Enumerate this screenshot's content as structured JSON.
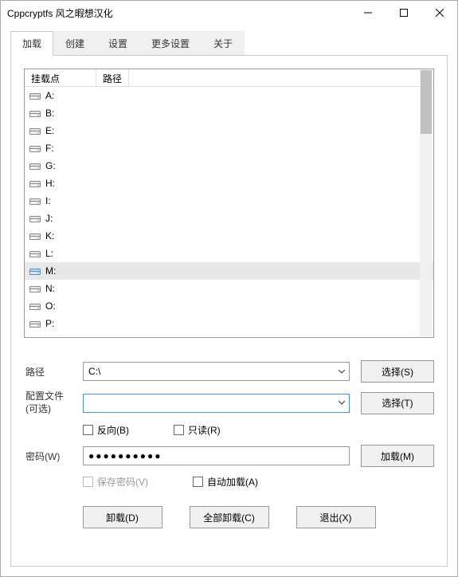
{
  "window": {
    "title": "Cppcryptfs 风之暇想汉化"
  },
  "tabs": [
    {
      "label": "加载",
      "active": true
    },
    {
      "label": "创建",
      "active": false
    },
    {
      "label": "设置",
      "active": false
    },
    {
      "label": "更多设置",
      "active": false
    },
    {
      "label": "关于",
      "active": false
    }
  ],
  "list": {
    "headers": {
      "mount": "挂载点",
      "path": "路径"
    },
    "drives": [
      {
        "letter": "A:",
        "selected": false
      },
      {
        "letter": "B:",
        "selected": false
      },
      {
        "letter": "E:",
        "selected": false
      },
      {
        "letter": "F:",
        "selected": false
      },
      {
        "letter": "G:",
        "selected": false
      },
      {
        "letter": "H:",
        "selected": false
      },
      {
        "letter": "I:",
        "selected": false
      },
      {
        "letter": "J:",
        "selected": false
      },
      {
        "letter": "K:",
        "selected": false
      },
      {
        "letter": "L:",
        "selected": false
      },
      {
        "letter": "M:",
        "selected": true
      },
      {
        "letter": "N:",
        "selected": false
      },
      {
        "letter": "O:",
        "selected": false
      },
      {
        "letter": "P:",
        "selected": false
      }
    ]
  },
  "form": {
    "path_label": "路径",
    "path_value": "C:\\",
    "config_label_1": "配置文件",
    "config_label_2": "(可选)",
    "config_value": "",
    "password_label": "密码(W)",
    "password_value": "●●●●●●●●●●",
    "select_s": "选择(S)",
    "select_t": "选择(T)",
    "mount_btn": "加载(M)",
    "reverse": "反向(B)",
    "readonly": "只读(R)",
    "save_password": "保存密码(V)",
    "auto_mount": "自动加载(A)"
  },
  "buttons": {
    "unmount": "卸载(D)",
    "unmount_all": "全部卸载(C)",
    "exit": "退出(X)"
  }
}
